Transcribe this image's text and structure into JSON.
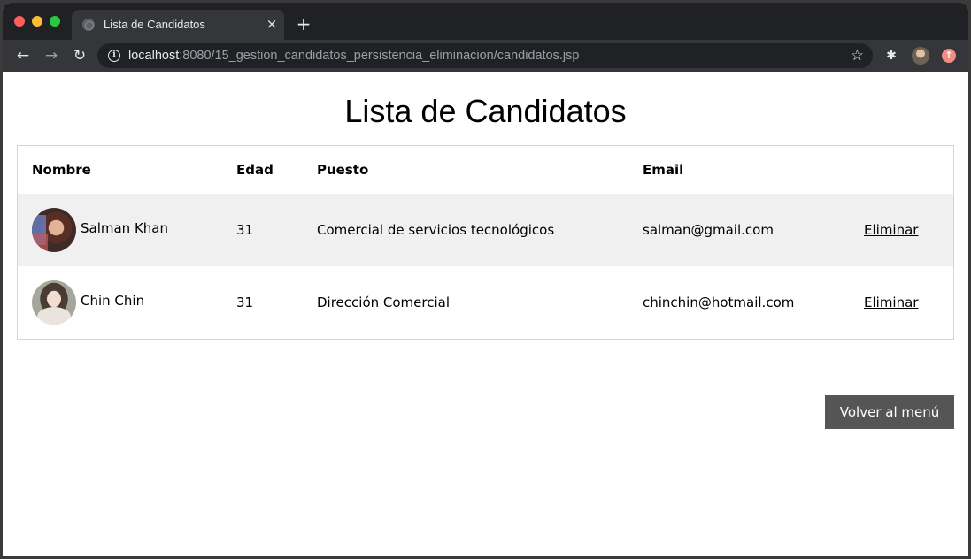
{
  "browser": {
    "tab": {
      "title": "Lista de Candidatos",
      "close_glyph": "×"
    },
    "new_tab_glyph": "+",
    "nav": {
      "back_glyph": "←",
      "forward_glyph": "→",
      "reload_glyph": "↻"
    },
    "url": {
      "host": "localhost",
      "path": ":8080/15_gestion_candidatos_persistencia_eliminacion/candidatos.jsp"
    },
    "icons": {
      "info": "i",
      "star": "☆",
      "extensions": "✱",
      "update": "↑"
    },
    "colors": {
      "tabstrip": "#202124",
      "toolbar": "#35363a",
      "close_red": "#ff5f57",
      "minimize_yellow": "#febc2e",
      "zoom_green": "#28c840"
    }
  },
  "page": {
    "title": "Lista de Candidatos",
    "table": {
      "headers": {
        "nombre": "Nombre",
        "edad": "Edad",
        "puesto": "Puesto",
        "email": "Email"
      },
      "rows": [
        {
          "nombre": "Salman Khan",
          "edad": "31",
          "puesto": "Comercial de servicios tecnológicos",
          "email": "salman@gmail.com",
          "action": "Eliminar"
        },
        {
          "nombre": "Chin Chin",
          "edad": "31",
          "puesto": "Dirección Comercial",
          "email": "chinchin@hotmail.com",
          "action": "Eliminar"
        }
      ]
    },
    "back_button": "Volver al menú",
    "colors": {
      "row_alt": "#f0f0f0",
      "button_bg": "#555555"
    }
  }
}
